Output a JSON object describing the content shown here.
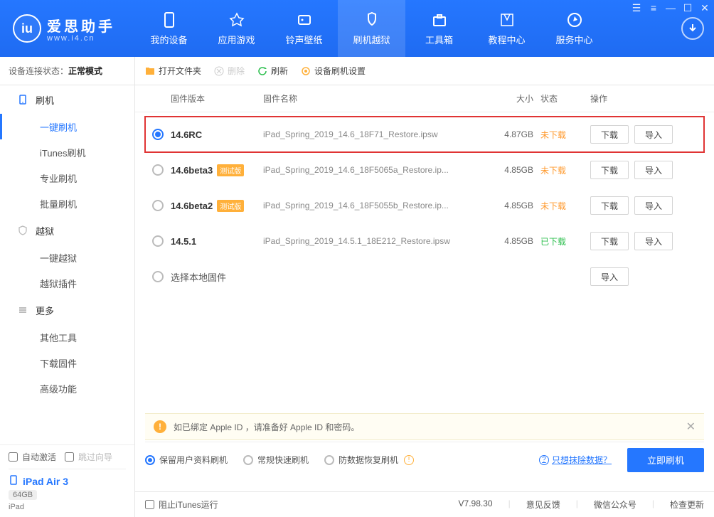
{
  "app": {
    "name": "爱思助手",
    "url": "www.i4.cn"
  },
  "nav": [
    {
      "label": "我的设备"
    },
    {
      "label": "应用游戏"
    },
    {
      "label": "铃声壁纸"
    },
    {
      "label": "刷机越狱",
      "active": true
    },
    {
      "label": "工具箱"
    },
    {
      "label": "教程中心"
    },
    {
      "label": "服务中心"
    }
  ],
  "status": {
    "prefix": "设备连接状态：",
    "value": "正常模式"
  },
  "side": {
    "group_flash": "刷机",
    "flash_items": [
      "一键刷机",
      "iTunes刷机",
      "专业刷机",
      "批量刷机"
    ],
    "group_jb": "越狱",
    "jb_items": [
      "一键越狱",
      "越狱插件"
    ],
    "group_more": "更多",
    "more_items": [
      "其他工具",
      "下载固件",
      "高级功能"
    ],
    "auto_activate": "自动激活",
    "skip_guide": "跳过向导",
    "device_name": "iPad Air 3",
    "storage": "64GB",
    "device_type": "iPad"
  },
  "toolbar": {
    "open_folder": "打开文件夹",
    "delete": "删除",
    "refresh": "刷新",
    "settings": "设备刷机设置"
  },
  "columns": {
    "version": "固件版本",
    "name": "固件名称",
    "size": "大小",
    "status": "状态",
    "ops": "操作"
  },
  "beta_tag": "测试版",
  "rows": [
    {
      "selected": true,
      "version": "14.6RC",
      "beta": false,
      "name": "iPad_Spring_2019_14.6_18F71_Restore.ipsw",
      "size": "4.87GB",
      "status": "未下载",
      "status_class": "st-pending",
      "download": true
    },
    {
      "selected": false,
      "version": "14.6beta3",
      "beta": true,
      "name": "iPad_Spring_2019_14.6_18F5065a_Restore.ip...",
      "size": "4.85GB",
      "status": "未下载",
      "status_class": "st-pending",
      "download": true
    },
    {
      "selected": false,
      "version": "14.6beta2",
      "beta": true,
      "name": "iPad_Spring_2019_14.6_18F5055b_Restore.ip...",
      "size": "4.85GB",
      "status": "未下载",
      "status_class": "st-pending",
      "download": true
    },
    {
      "selected": false,
      "version": "14.5.1",
      "beta": false,
      "name": "iPad_Spring_2019_14.5.1_18E212_Restore.ipsw",
      "size": "4.85GB",
      "status": "已下载",
      "status_class": "st-done",
      "download": true
    }
  ],
  "local_row": "选择本地固件",
  "actions": {
    "download": "下载",
    "import": "导入"
  },
  "warning": "如已绑定 Apple ID ，请准备好 Apple ID 和密码。",
  "options": {
    "keep_data": "保留用户资料刷机",
    "normal": "常规快速刷机",
    "recover": "防数据恢复刷机",
    "wipe_link": "只想抹除数据？",
    "primary": "立即刷机"
  },
  "footer": {
    "block_itunes": "阻止iTunes运行",
    "version": "V7.98.30",
    "feedback": "意见反馈",
    "wechat": "微信公众号",
    "update": "检查更新"
  }
}
